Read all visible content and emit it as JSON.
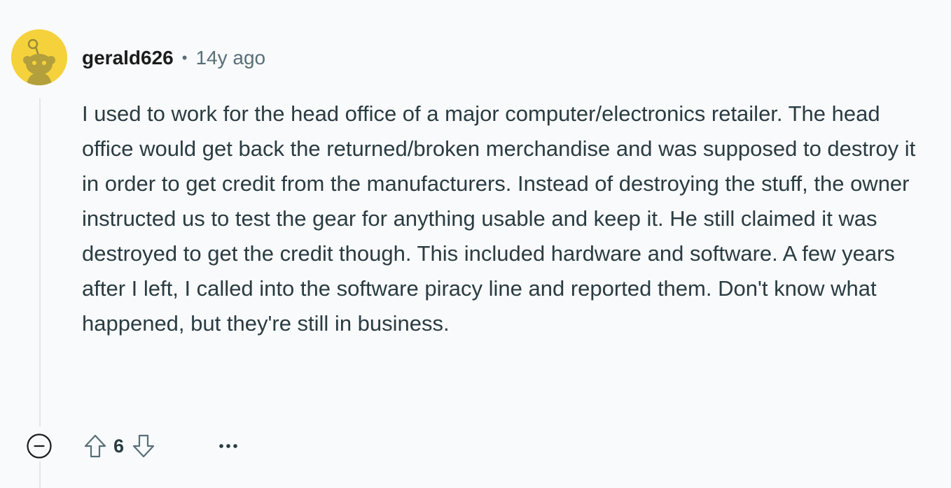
{
  "comment": {
    "author": "gerald626",
    "separator": "•",
    "age": "14y ago",
    "body": "I used to work for the head office of a major computer/electronics retailer. The head office would get back the returned/broken merchandise and was supposed to destroy it in order to get credit from the manufacturers. Instead of destroying the stuff, the owner instructed us to test the gear for anything usable and keep it. He still claimed it was destroyed to get the credit though. This included hardware and software. A few years after I left, I called into the software piracy line and reported them. Don't know what happened, but they're still in business.",
    "score": "6"
  },
  "icons": {
    "avatar": "snoo-avatar",
    "collapse": "minus-circle-icon",
    "upvote": "arrow-up-icon",
    "downvote": "arrow-down-icon",
    "more": "ellipsis-icon"
  },
  "colors": {
    "background": "#f9fafb",
    "avatar_bg": "#f5d23c",
    "text": "#2a3c42",
    "meta": "#576f76",
    "thread_line": "#e3e6e8"
  }
}
